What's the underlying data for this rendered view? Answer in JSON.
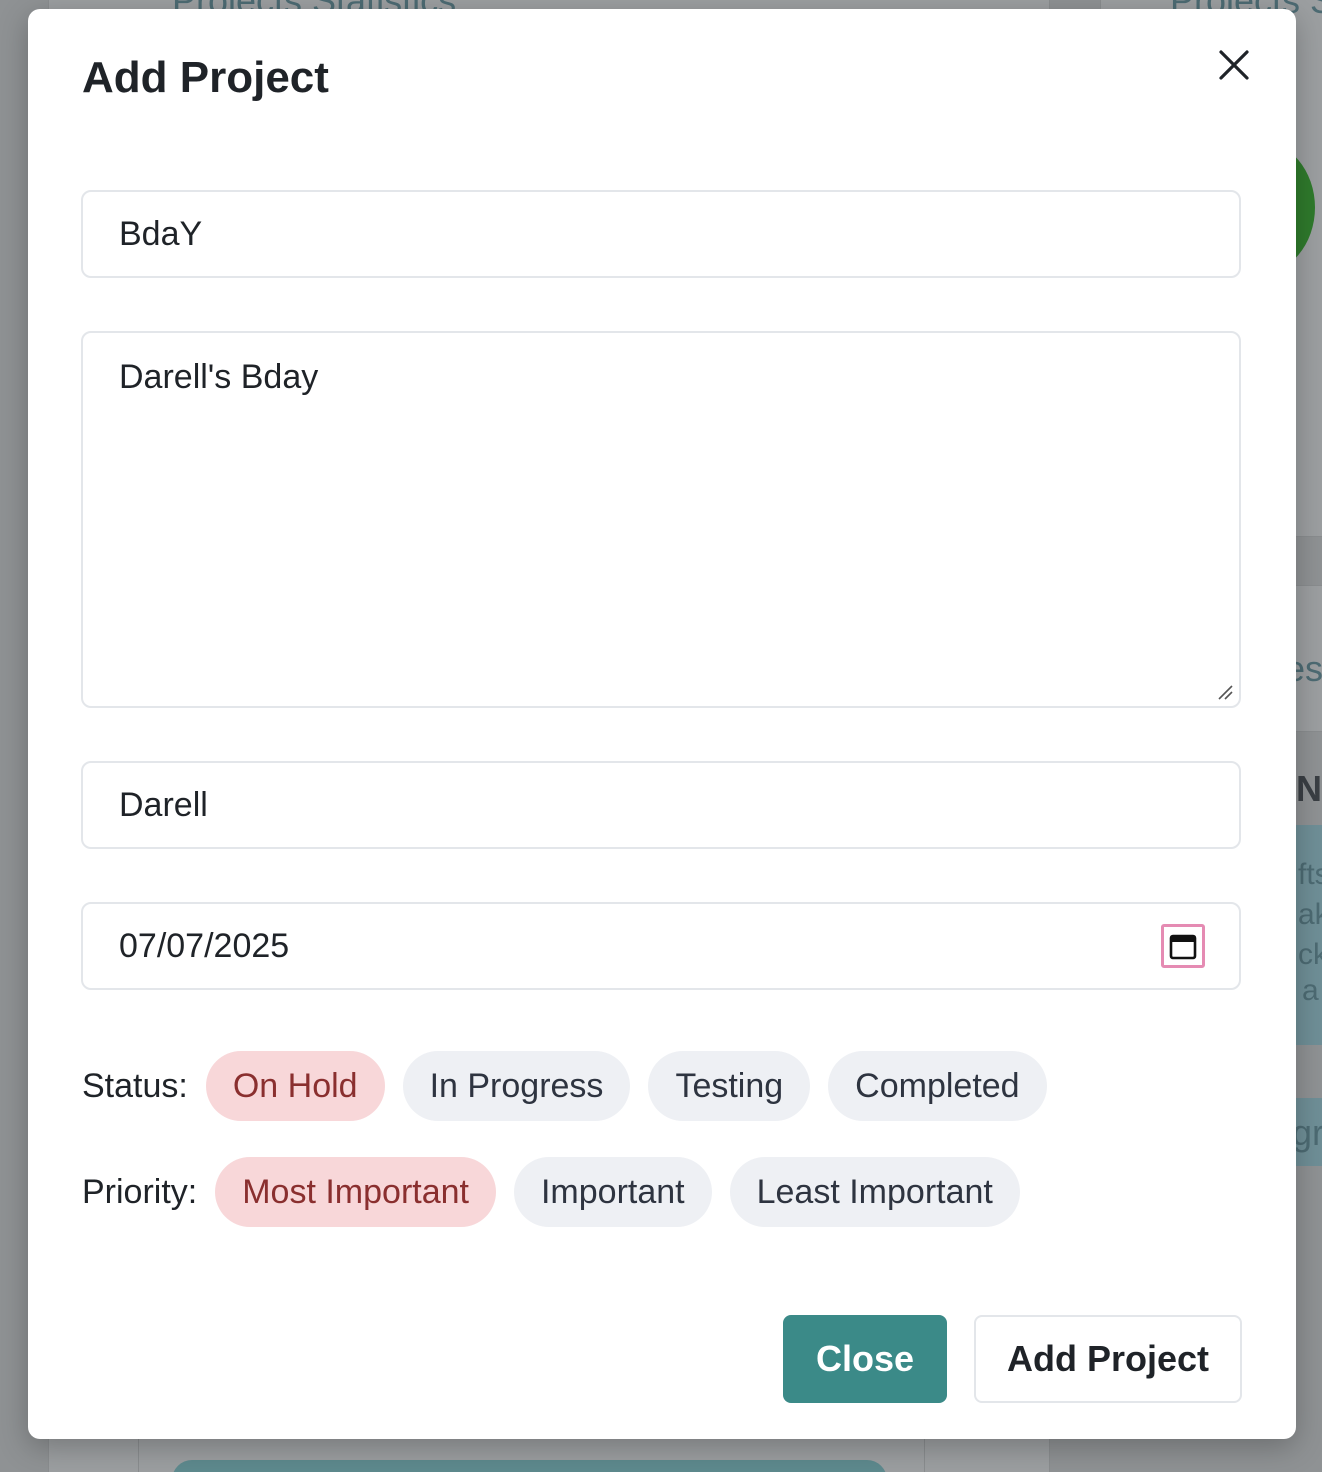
{
  "background": {
    "left_card_title": "Projects Statistics",
    "right_card_title": "Projects S",
    "right_fragment_1": "es",
    "right_fragment_2": "N",
    "right_fragment_3": "fts",
    "right_fragment_4": "ake",
    "right_fragment_5": "ck",
    "right_fragment_6": "a",
    "right_fragment_7": "gr"
  },
  "modal": {
    "title": "Add Project",
    "close_icon": "close-icon",
    "project_name_value": "BdaY",
    "description_value": "Darell's Bday",
    "assignee_value": "Darell",
    "due_date_value": "07/07/2025",
    "calendar_icon": "calendar-icon",
    "status": {
      "label": "Status:",
      "options": [
        "On Hold",
        "In Progress",
        "Testing",
        "Completed"
      ],
      "selected": "On Hold"
    },
    "priority": {
      "label": "Priority:",
      "options": [
        "Most Important",
        "Important",
        "Least Important"
      ],
      "selected": "Most Important"
    },
    "close_button_label": "Close",
    "add_button_label": "Add Project"
  },
  "colors": {
    "primary": "#3b8a88",
    "active_pill_bg": "#f8d7d9",
    "active_pill_text": "#8a2f2f",
    "pill_bg": "#eef0f4",
    "calendar_focus": "#e58bb3"
  }
}
